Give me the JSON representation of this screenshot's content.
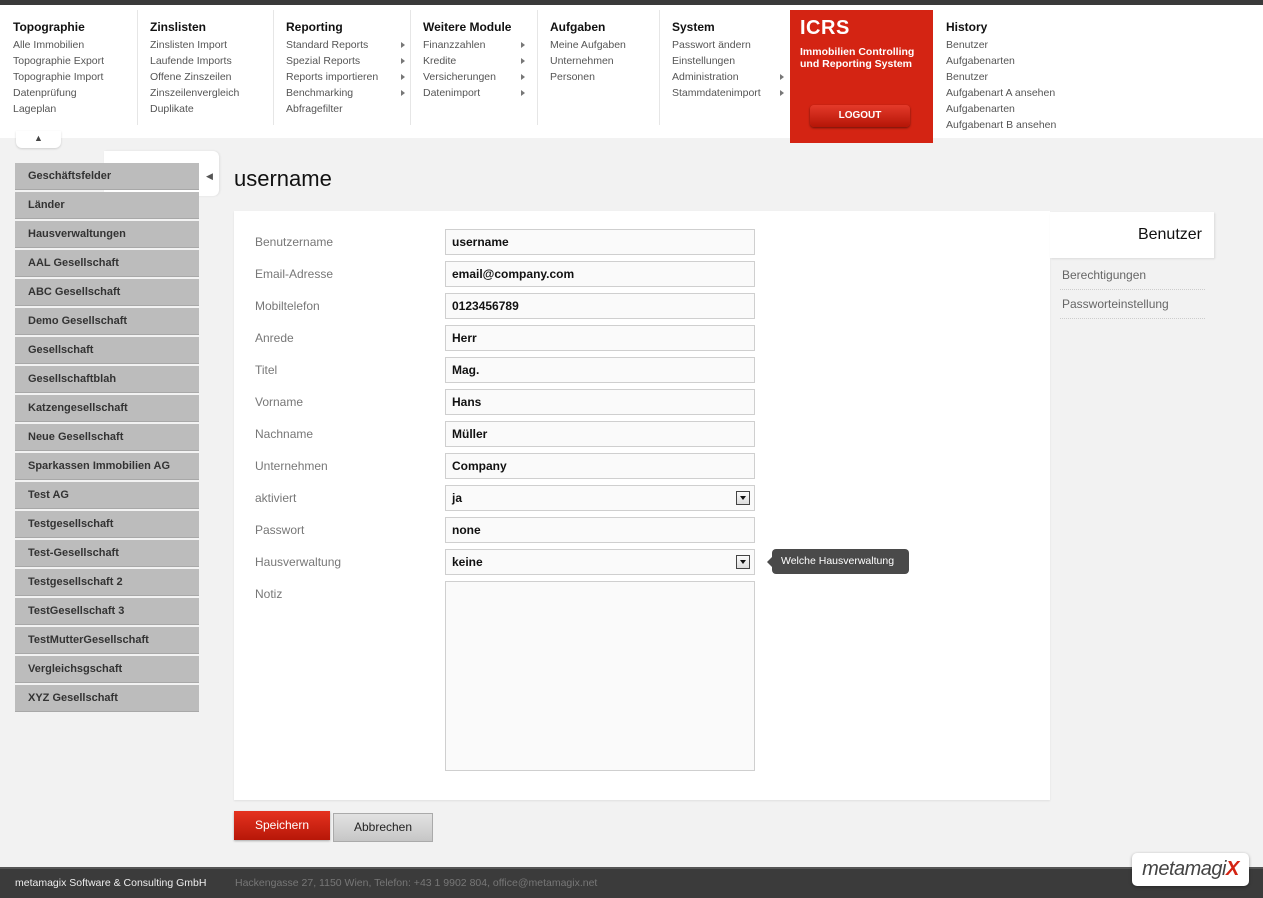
{
  "menu": [
    {
      "title": "Topographie",
      "items": [
        {
          "label": "Alle Immobilien"
        },
        {
          "label": "Topographie Export"
        },
        {
          "label": "Topographie Import"
        },
        {
          "label": "Datenprüfung"
        },
        {
          "label": "Lageplan"
        }
      ]
    },
    {
      "title": "Zinslisten",
      "items": [
        {
          "label": "Zinslisten Import"
        },
        {
          "label": "Laufende Imports"
        },
        {
          "label": "Offene Zinszeilen"
        },
        {
          "label": "Zinszeilenvergleich"
        },
        {
          "label": "Duplikate"
        }
      ]
    },
    {
      "title": "Reporting",
      "items": [
        {
          "label": "Standard Reports",
          "submenu": true
        },
        {
          "label": "Spezial Reports",
          "submenu": true
        },
        {
          "label": "Reports importieren",
          "submenu": true
        },
        {
          "label": "Benchmarking",
          "submenu": true
        },
        {
          "label": "Abfragefilter"
        }
      ]
    },
    {
      "title": "Weitere Module",
      "items": [
        {
          "label": "Finanzzahlen",
          "submenu": true
        },
        {
          "label": "Kredite",
          "submenu": true
        },
        {
          "label": "Versicherungen",
          "submenu": true
        },
        {
          "label": "Datenimport",
          "submenu": true
        }
      ]
    },
    {
      "title": "Aufgaben",
      "items": [
        {
          "label": "Meine Aufgaben"
        },
        {
          "label": "Unternehmen"
        },
        {
          "label": "Personen"
        }
      ]
    },
    {
      "title": "System",
      "items": [
        {
          "label": "Passwort ändern"
        },
        {
          "label": "Einstellungen"
        },
        {
          "label": "Administration",
          "submenu": true
        },
        {
          "label": "Stammdatenimport",
          "submenu": true
        }
      ]
    }
  ],
  "history": {
    "title": "History",
    "items": [
      "Benutzer",
      "Aufgabenarten",
      "Benutzer",
      "Aufgabenart A ansehen",
      "Aufgabenarten",
      "Aufgabenart B ansehen"
    ]
  },
  "brand": {
    "title": "ICRS",
    "subtitle_line1": "Immobilien Controlling",
    "subtitle_line2": "und Reporting System",
    "logout_label": "LOGOUT",
    "accent_color": "#d42413"
  },
  "sidebar": {
    "items": [
      "Geschäftsfelder",
      "Länder",
      "Hausverwaltungen",
      "AAL Gesellschaft",
      "ABC Gesellschaft",
      "Demo Gesellschaft",
      "Gesellschaft",
      "Gesellschaftblah",
      "Katzengesellschaft",
      "Neue Gesellschaft",
      "Sparkassen Immobilien AG",
      "Test AG",
      "Testgesellschaft",
      "Test-Gesellschaft",
      "Testgesellschaft 2",
      "TestGesellschaft 3",
      "TestMutterGesellschaft",
      "Vergleichsgschaft",
      "XYZ Gesellschaft"
    ]
  },
  "page": {
    "title": "username"
  },
  "form": {
    "fields": [
      {
        "label": "Benutzername",
        "value": "username",
        "type": "text"
      },
      {
        "label": "Email-Adresse",
        "value": "email@company.com",
        "type": "text"
      },
      {
        "label": "Mobiltelefon",
        "value": "0123456789",
        "type": "text"
      },
      {
        "label": "Anrede",
        "value": "Herr",
        "type": "text"
      },
      {
        "label": "Titel",
        "value": "Mag.",
        "type": "text"
      },
      {
        "label": "Vorname",
        "value": "Hans",
        "type": "text"
      },
      {
        "label": "Nachname",
        "value": "Müller",
        "type": "text"
      },
      {
        "label": "Unternehmen",
        "value": "Company",
        "type": "text"
      },
      {
        "label": "aktiviert",
        "value": "ja",
        "type": "select"
      },
      {
        "label": "Passwort",
        "value": "none",
        "type": "text"
      },
      {
        "label": "Hausverwaltung",
        "value": "keine",
        "type": "select"
      }
    ],
    "notiz_label": "Notiz",
    "notiz_value": "",
    "tooltip": "Welche Hausverwaltung"
  },
  "right_tabs": {
    "active": "Benutzer",
    "items": [
      "Berechtigungen",
      "Passworteinstellung"
    ]
  },
  "actions": {
    "save_label": "Speichern",
    "cancel_label": "Abbrechen"
  },
  "footer": {
    "company": "metamagix Software & Consulting GmbH",
    "address": "Hackengasse 27, 1150 Wien, Telefon: +43 1 9902 804, office@metamagix.net",
    "logo_text": "metamagi",
    "logo_mark": "X"
  }
}
